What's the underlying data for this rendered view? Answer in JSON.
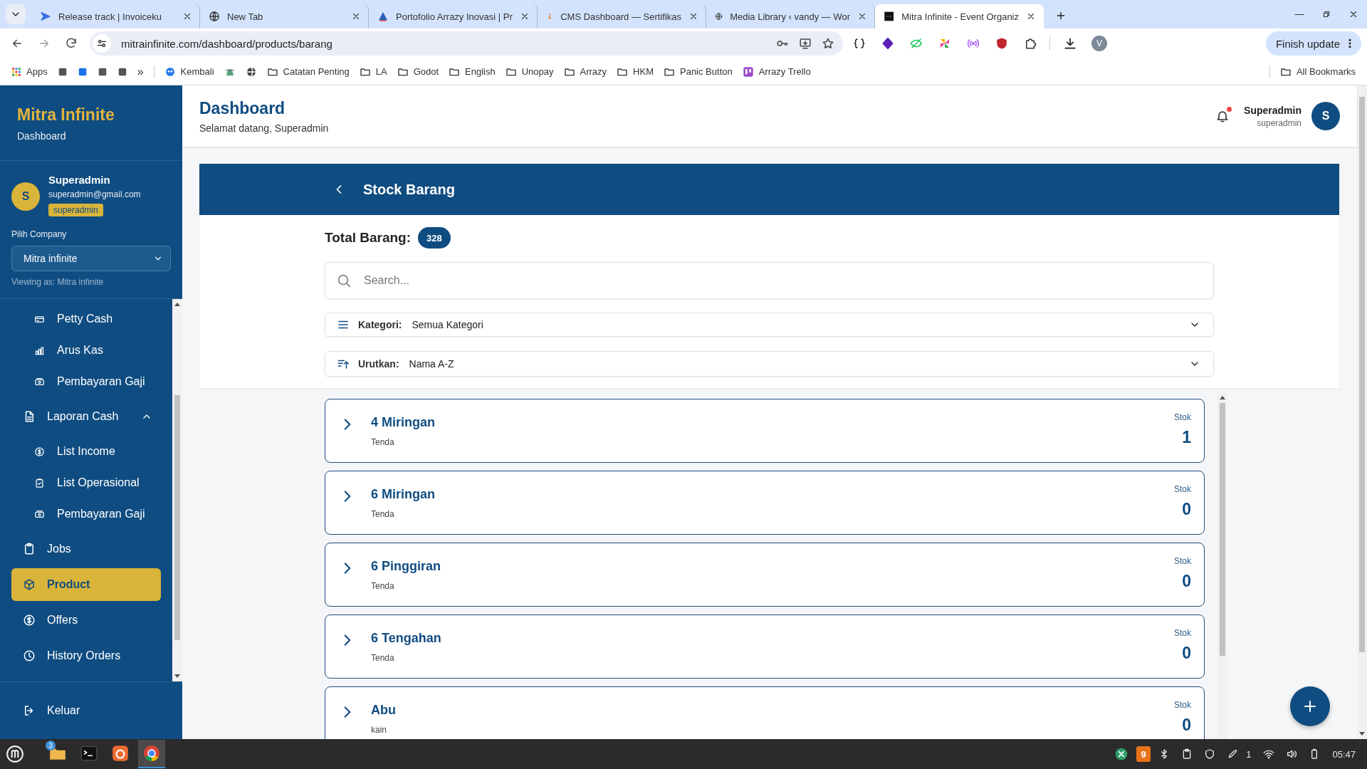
{
  "browser": {
    "tabs": [
      {
        "title": "Release track | Invoiceku",
        "selected": false
      },
      {
        "title": "New Tab",
        "selected": false
      },
      {
        "title": "Portofolio Arrazy Inovasi | Pr",
        "selected": false
      },
      {
        "title": "CMS Dashboard — Sertifikas",
        "selected": false
      },
      {
        "title": "Media Library ‹ vandy — Wor",
        "selected": false
      },
      {
        "title": "Mitra Infinite - Event Organiz",
        "selected": true
      }
    ],
    "url": "mitrainfinite.com/dashboard/products/barang",
    "profile_initial": "V",
    "update_button": "Finish update",
    "bookmarks": {
      "apps": "Apps",
      "overflow": "»",
      "items": [
        "Kembali",
        "Catatan Penting",
        "LA",
        "Godot",
        "English",
        "Unopay",
        "Arrazy",
        "HKM",
        "Panic Button",
        "Arrazy Trello"
      ],
      "all": "All Bookmarks"
    }
  },
  "sidebar": {
    "brand": "Mitra Infinite",
    "subtitle": "Dashboard",
    "user": {
      "initial": "S",
      "name": "Superadmin",
      "email": "superadmin@gmail.com",
      "role": "superadmin"
    },
    "company": {
      "label": "Pilih Company",
      "value": "Mitra infinite",
      "viewing": "Viewing as: Mitra infinite"
    },
    "nav_top_children": [
      {
        "label": "Petty Cash",
        "selected": false
      },
      {
        "label": "Arus Kas",
        "selected": false
      },
      {
        "label": "Pembayaran Gaji",
        "selected": false
      }
    ],
    "nav": [
      {
        "label": "Laporan Cash",
        "selected": false,
        "expanded": true,
        "children": [
          {
            "label": "List Income",
            "selected": false
          },
          {
            "label": "List Operasional",
            "selected": false
          },
          {
            "label": "Pembayaran Gaji",
            "selected": false
          }
        ]
      },
      {
        "label": "Jobs",
        "selected": false
      },
      {
        "label": "Product",
        "selected": true
      },
      {
        "label": "Offers",
        "selected": false
      },
      {
        "label": "History Orders",
        "selected": false
      }
    ],
    "logout": "Keluar"
  },
  "header": {
    "title": "Dashboard",
    "subtitle": "Selamat datang, Superadmin",
    "unread_notifications": true,
    "user": {
      "name": "Superadmin",
      "role": "superadmin",
      "initial": "S"
    }
  },
  "stock": {
    "title": "Stock Barang",
    "total_label": "Total Barang:",
    "total": "328",
    "search": {
      "placeholder": "Search..."
    },
    "filters": [
      {
        "label": "Kategori:",
        "value": "Semua Kategori"
      },
      {
        "label": "Urutkan:",
        "value": "Nama A-Z"
      }
    ],
    "items": [
      {
        "name": "4 Miringan",
        "category": "Tenda",
        "stock_label": "Stok",
        "stock": "1",
        "expanded": false
      },
      {
        "name": "6 Miringan",
        "category": "Tenda",
        "stock_label": "Stok",
        "stock": "0",
        "expanded": false
      },
      {
        "name": "6 Pinggiran",
        "category": "Tenda",
        "stock_label": "Stok",
        "stock": "0",
        "expanded": false
      },
      {
        "name": "6 Tengahan",
        "category": "Tenda",
        "stock_label": "Stok",
        "stock": "0",
        "expanded": false
      },
      {
        "name": "Abu",
        "category": "kain",
        "stock_label": "Stok",
        "stock": "0",
        "expanded": false
      }
    ]
  },
  "taskbar": {
    "apps": [
      {
        "badge": "3",
        "active": false
      },
      {
        "active": false
      },
      {
        "active": false
      },
      {
        "active": true
      }
    ],
    "update_count": "9",
    "notification_count": "1",
    "time": "05:47"
  }
}
